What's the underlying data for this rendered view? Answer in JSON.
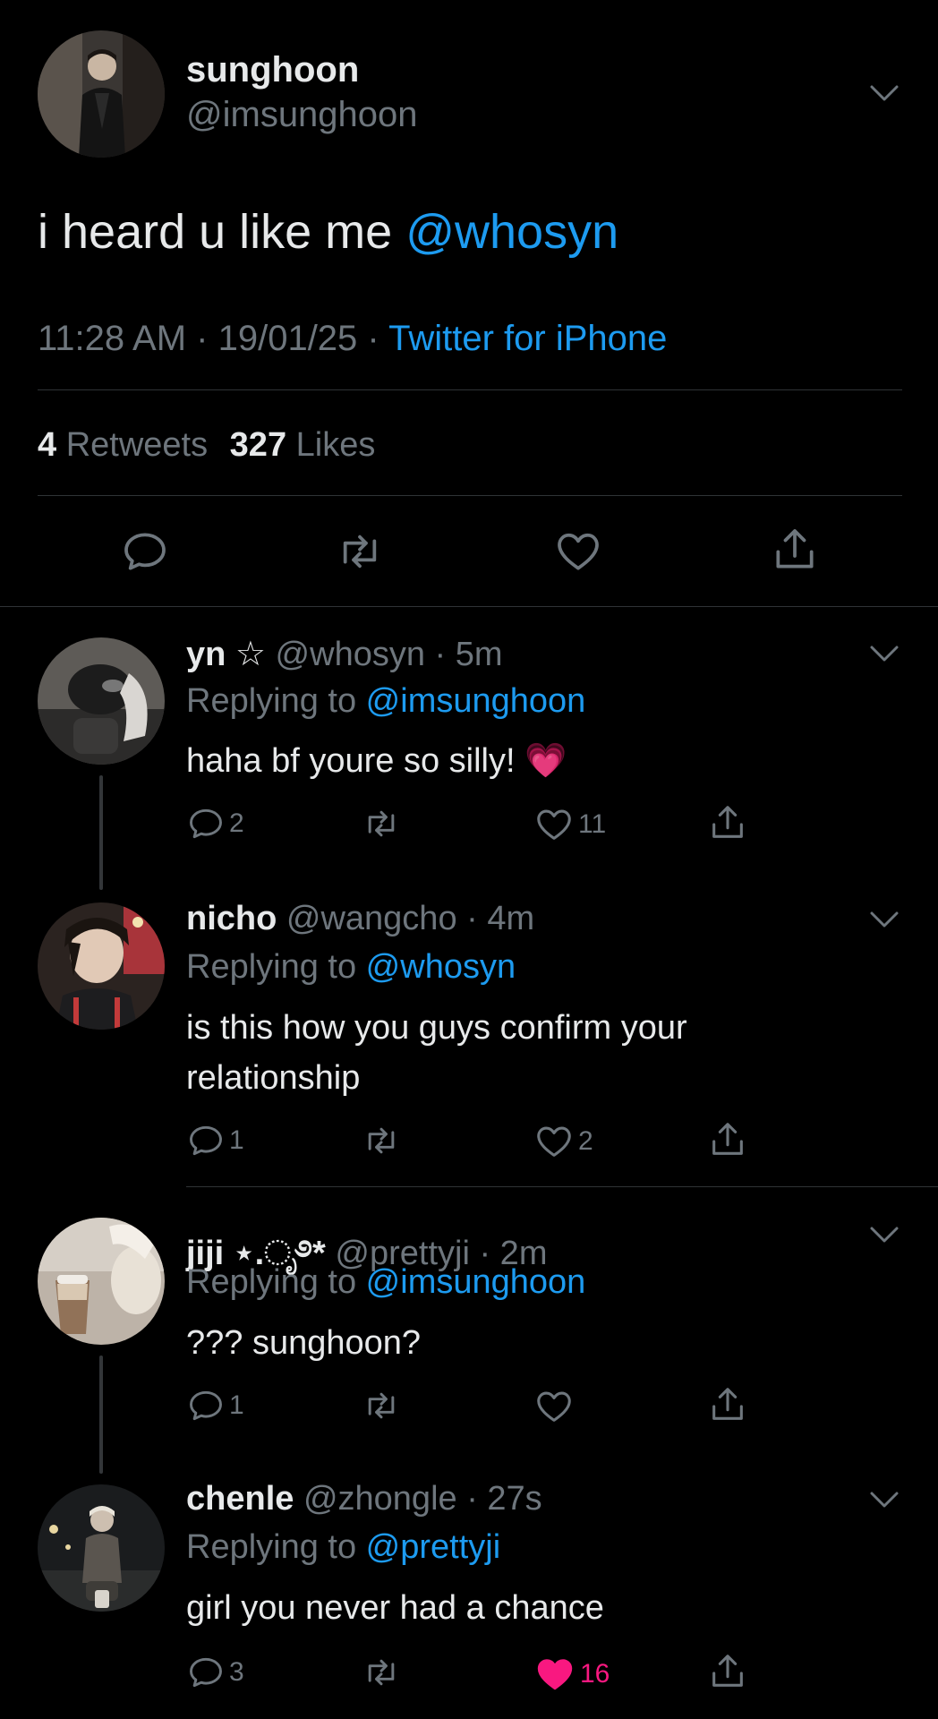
{
  "main_tweet": {
    "display_name": "sunghoon",
    "handle": "@imsunghoon",
    "text": "i heard u like me ",
    "mention": "@whosyn",
    "time": "11:28 AM",
    "dot1": " · ",
    "date": "19/01/25",
    "dot2": " · ",
    "source": "Twitter for iPhone",
    "retweets_count": "4",
    "retweets_label": "Retweets",
    "likes_count": "327",
    "likes_label": "Likes"
  },
  "icons": {
    "reply": "reply-icon",
    "retweet": "retweet-icon",
    "like": "heart-icon",
    "share": "share-icon",
    "more": "chevron-down-icon"
  },
  "colors": {
    "background": "#000000",
    "text": "#e7e9ea",
    "secondary": "#6e767d",
    "accent": "#1d9bf0",
    "liked": "#f91880"
  },
  "replies": [
    {
      "name": "yn ☆",
      "handle": "@whosyn",
      "time": "· 5m",
      "replying_label": "Replying to ",
      "replying_to": "@imsunghoon",
      "text": "haha bf youre so silly! 💗",
      "reply_count": "2",
      "retweet_count": "",
      "like_count": "11",
      "liked": false
    },
    {
      "name": "nicho",
      "handle": "@wangcho",
      "time": "· 4m",
      "replying_label": "Replying to ",
      "replying_to": "@whosyn",
      "text": "is this how you guys confirm your relationship",
      "reply_count": "1",
      "retweet_count": "",
      "like_count": "2",
      "liked": false
    },
    {
      "name": "jiji ⋆.ೃ࿔*",
      "handle": "@prettyji",
      "time": "· 2m",
      "replying_label": "Replying to ",
      "replying_to": "@imsunghoon",
      "text": "??? sunghoon?",
      "reply_count": "1",
      "retweet_count": "",
      "like_count": "",
      "liked": false
    },
    {
      "name": "chenle",
      "handle": "@zhongle",
      "time": "· 27s",
      "replying_label": "Replying to ",
      "replying_to": "@prettyji",
      "text": "girl you never had a chance",
      "reply_count": "3",
      "retweet_count": "",
      "like_count": "16",
      "liked": true
    }
  ]
}
